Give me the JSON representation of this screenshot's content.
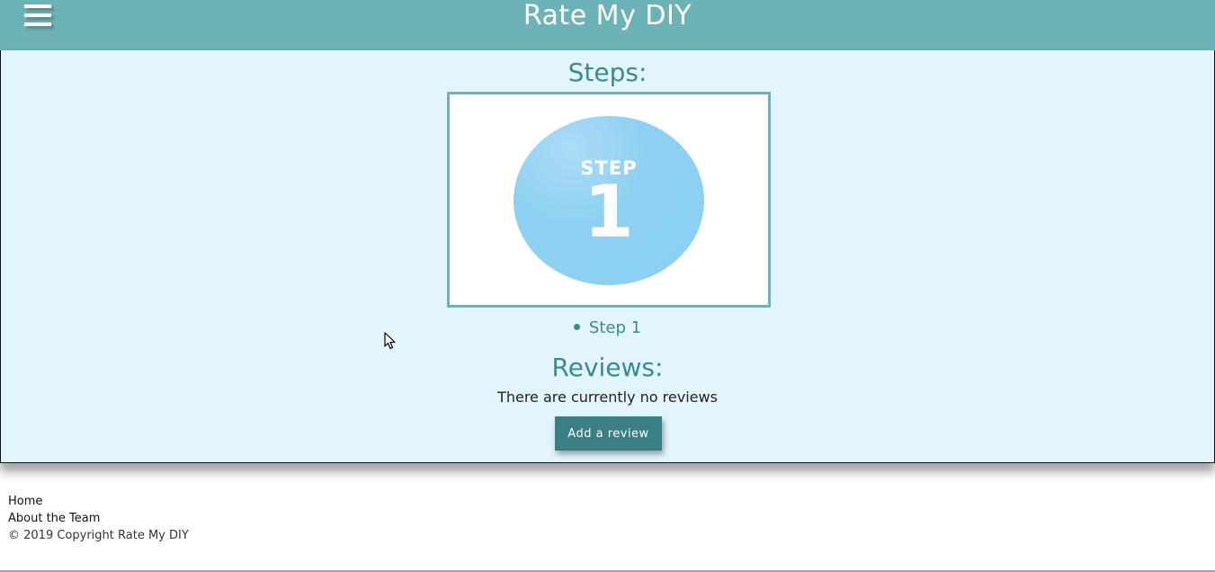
{
  "header": {
    "title": "Rate My DIY",
    "menu_icon": "hamburger-menu-icon",
    "background_color": "#6db2b7"
  },
  "main": {
    "background_color": "#e3f5fc",
    "steps_heading": "Steps:",
    "step_image": {
      "word": "STEP",
      "number": "1",
      "circle_color": "#8ed0f2"
    },
    "steps": [
      "Step 1"
    ],
    "reviews_heading": "Reviews:",
    "no_reviews_text": "There are currently no reviews",
    "add_review_label": "Add a review",
    "accent_color": "#3a8a8f",
    "button_color": "#3a7f84"
  },
  "footer": {
    "links": [
      "Home",
      "About the Team"
    ],
    "copyright": "© 2019 Copyright Rate My DIY"
  },
  "cursor_icon": "mouse-pointer-icon"
}
